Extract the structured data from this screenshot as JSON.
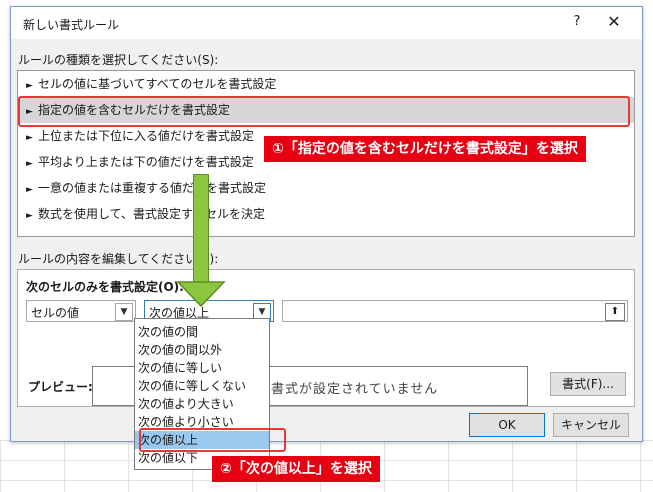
{
  "dialog": {
    "title": "新しい書式ルール",
    "help_label": "?",
    "close_label": "✕"
  },
  "rule_type": {
    "label": "ルールの種類を選択してください(S):",
    "items": [
      "セルの値に基づいてすべてのセルを書式設定",
      "指定の値を含むセルだけを書式設定",
      "上位または下位に入る値だけを書式設定",
      "平均より上または下の値だけを書式設定",
      "一意の値または重複する値だけを書式設定",
      "数式を使用して、書式設定するセルを決定"
    ],
    "selected_index": 1
  },
  "edit": {
    "label": "ルールの内容を編集してください(E):",
    "subheading": "次のセルのみを書式設定(O):",
    "combo1_value": "セルの値",
    "combo2_value": "次の値以上",
    "ref_button": "⬆",
    "preview_label": "プレビュー:",
    "preview_text": "書式が設定されていません",
    "format_button": "書式(F)..."
  },
  "dropdown": {
    "options": [
      "次の値の間",
      "次の値の間以外",
      "次の値に等しい",
      "次の値に等しくない",
      "次の値より大きい",
      "次の値より小さい",
      "次の値以上",
      "次の値以下"
    ],
    "selected_index": 6
  },
  "buttons": {
    "ok": "OK",
    "cancel": "キャンセル"
  },
  "annotations": {
    "callout1": "①「指定の値を含むセルだけを書式設定」を選択",
    "callout2": "②「次の値以上」を選択",
    "accent_red": "#e60012",
    "arrow_green": "#8cc63f"
  }
}
